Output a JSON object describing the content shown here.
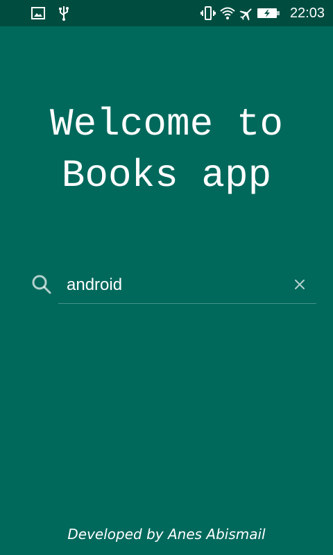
{
  "status_bar": {
    "time": "22:03",
    "left_icons": [
      "image-icon",
      "usb-icon"
    ],
    "right_icons": [
      "vibrate-icon",
      "wifi-icon",
      "airplane-icon",
      "battery-charging-icon"
    ]
  },
  "welcome": {
    "line1": "Welcome to",
    "line2": "Books app"
  },
  "search": {
    "value": "android",
    "placeholder": "",
    "clear_icon": "close-icon",
    "search_icon": "search-icon"
  },
  "footer": {
    "text": "Developed by Anes Abismail"
  },
  "colors": {
    "background": "#00695c",
    "status_bar": "#004d40",
    "text": "#ffffff"
  }
}
